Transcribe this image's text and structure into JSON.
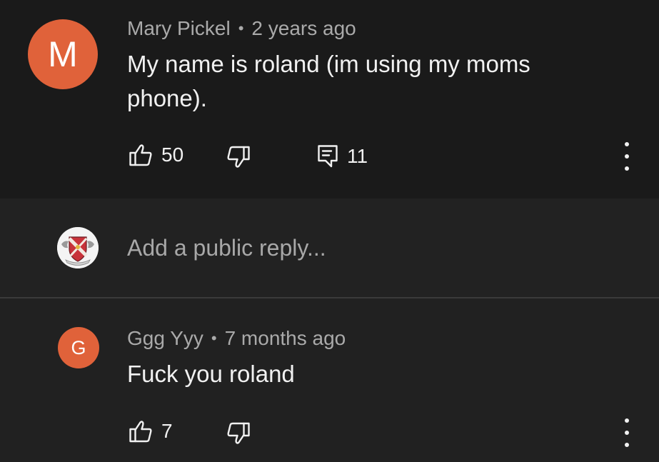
{
  "comment_main": {
    "avatar_letter": "M",
    "author": "Mary Pickel",
    "separator": "•",
    "time": "2 years ago",
    "text_line1": "My name is roland (im using my moms",
    "text_line2": "phone).",
    "like_count": "50",
    "reply_count": "11",
    "avatar_color": "#e0623a"
  },
  "reply_box": {
    "placeholder": "Add a public reply..."
  },
  "comment_reply": {
    "avatar_letter": "G",
    "author": "Ggg Yyy",
    "separator": "•",
    "time": "7 months ago",
    "text": "Fuck you roland",
    "like_count": "7",
    "avatar_color": "#e0623a"
  },
  "icons": {
    "like": "thumbs-up-icon",
    "dislike": "thumbs-down-icon",
    "replies": "comment-icon",
    "more": "more-vertical-icon"
  }
}
